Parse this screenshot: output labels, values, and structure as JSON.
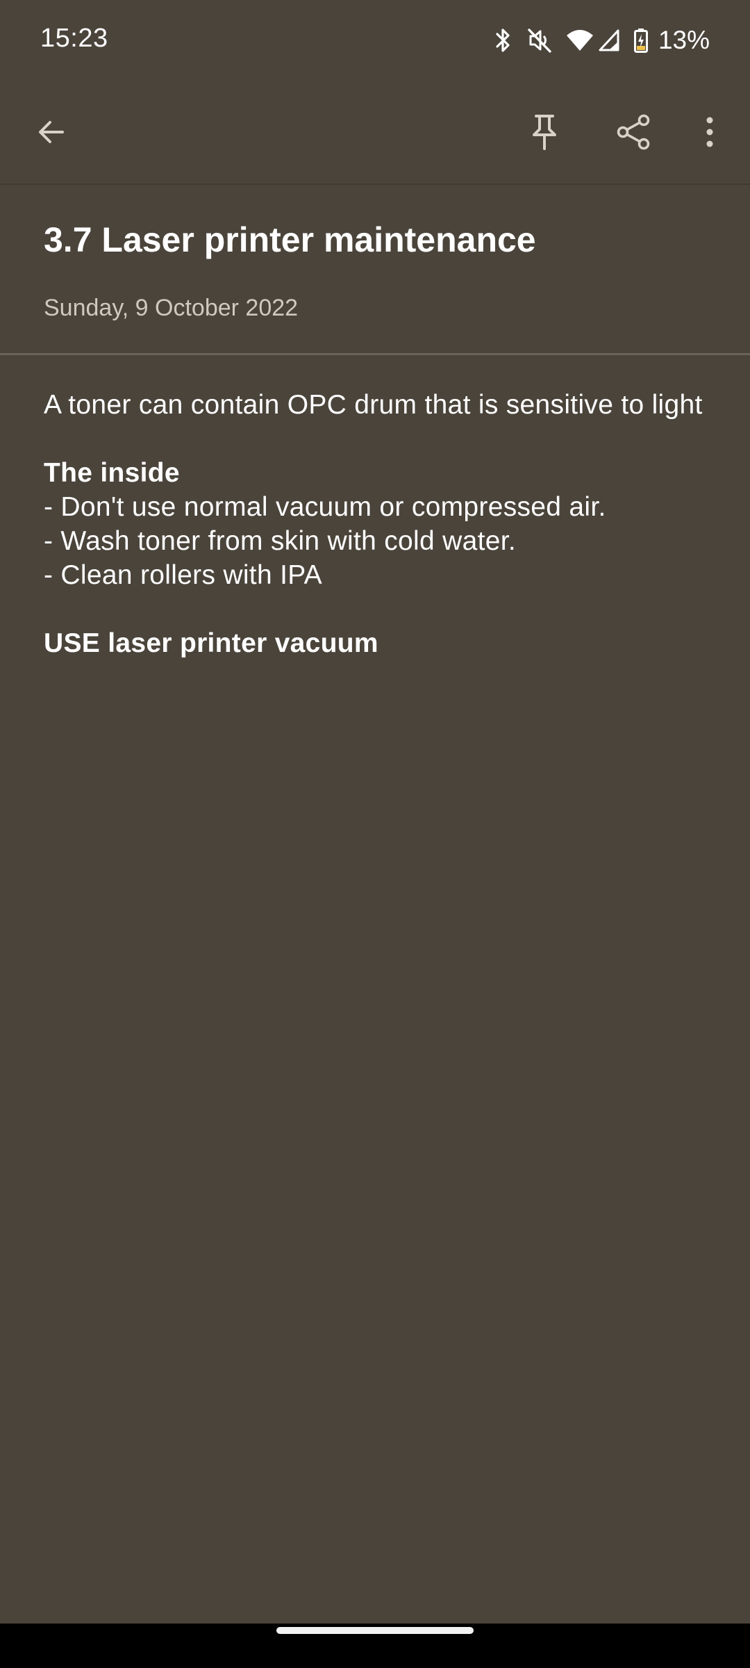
{
  "status_bar": {
    "time": "15:23",
    "battery_percent": "13%",
    "icons": [
      "bluetooth-icon",
      "mute-icon",
      "wifi-icon",
      "signal-icon",
      "battery-charging-icon"
    ]
  },
  "app_bar": {
    "back_icon": "arrow-back-icon",
    "pin_icon": "pin-icon",
    "share_icon": "share-icon",
    "more_icon": "more-vertical-icon"
  },
  "note": {
    "title": "3.7 Laser printer maintenance",
    "date": "Sunday, 9 October 2022",
    "body": {
      "intro": "A toner can contain OPC drum that is sensitive to light",
      "section_heading": "The inside",
      "items": [
        "- Don't use normal vacuum or compressed air.",
        "- Wash toner from skin with cold water.",
        "- Clean rollers with IPA"
      ],
      "footer_note": "USE laser printer vacuum"
    }
  },
  "colors": {
    "background": "#4a443b",
    "text": "#ffffff",
    "secondary_text": "#cfc9bf",
    "divider": "#6a645b",
    "nav_bar": "#000000"
  }
}
